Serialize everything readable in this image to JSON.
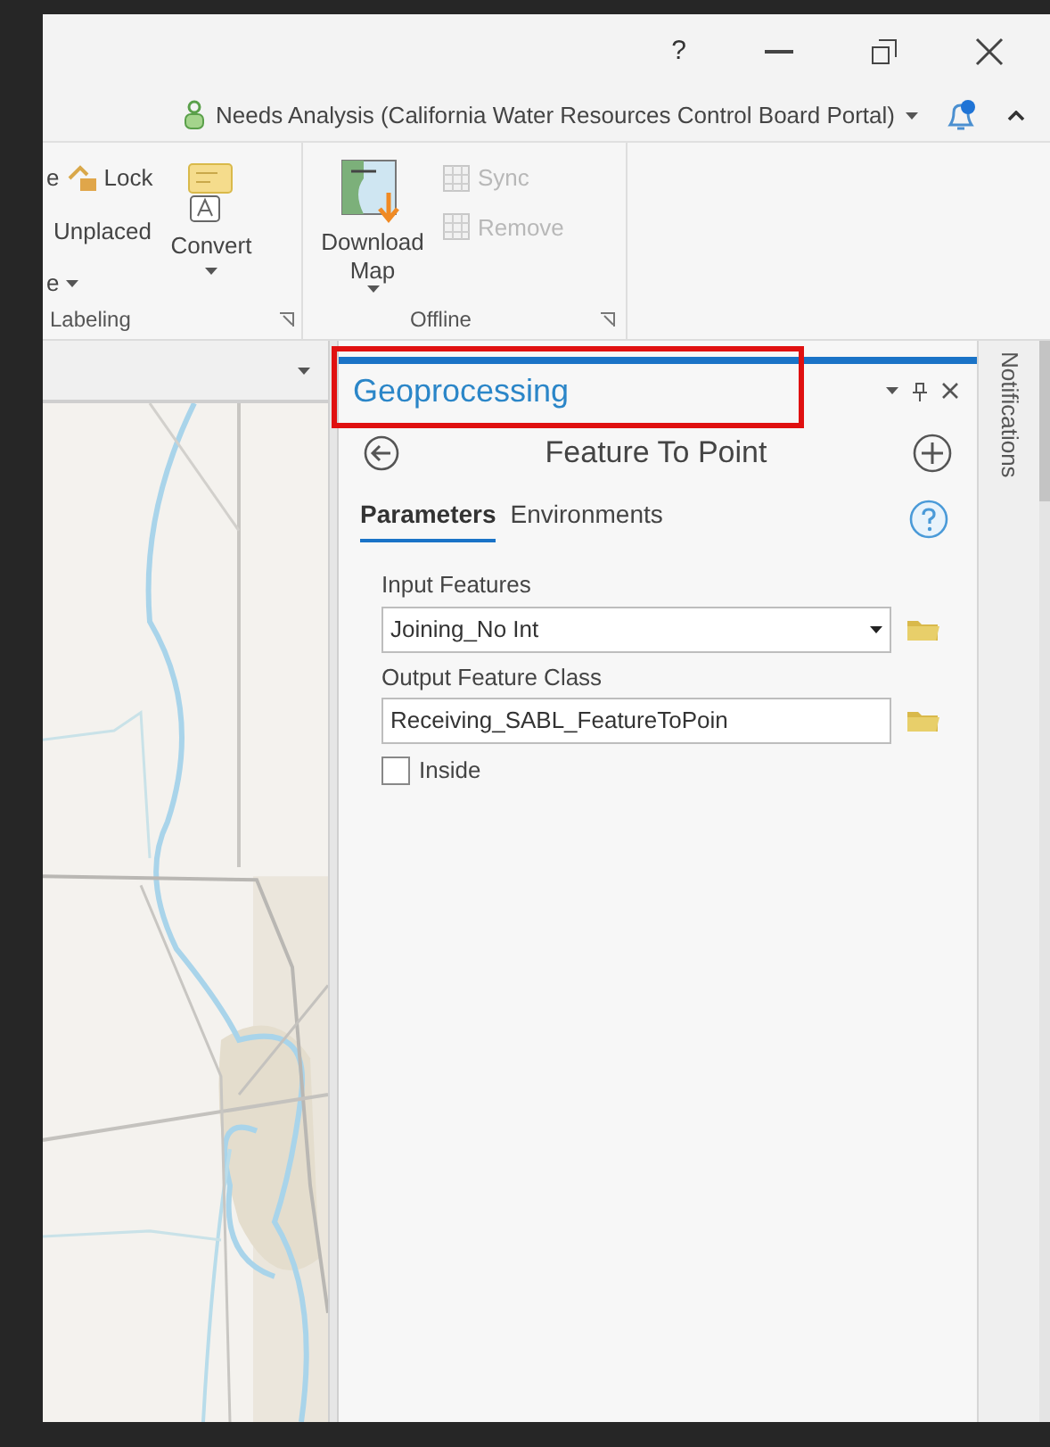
{
  "window": {
    "help": "?"
  },
  "account": {
    "title": "Needs Analysis (California Water Resources Control Board Portal)"
  },
  "labeling": {
    "label": "Labeling",
    "cut_top": "e",
    "cut_bottom": "e",
    "lock": "Lock",
    "unplaced": "Unplaced",
    "convert": "Convert"
  },
  "offline": {
    "label": "Offline",
    "download": "Download Map",
    "actions": [
      {
        "label": "Sync",
        "disabled": true
      },
      {
        "label": "Remove",
        "disabled": true
      }
    ]
  },
  "geoprocessing": {
    "title": "Geoprocessing",
    "tool": "Feature To Point",
    "tabs": [
      {
        "label": "Parameters",
        "selected": true
      },
      {
        "label": "Environments",
        "selected": false
      }
    ],
    "params": [
      {
        "kind": "dropdown",
        "label": "Input Features",
        "value": "Joining_No Int"
      },
      {
        "kind": "text",
        "label": "Output Feature Class",
        "value": "Receiving_SABL_FeatureToPoin"
      },
      {
        "kind": "checkbox",
        "label": "Inside",
        "checked": false
      }
    ]
  },
  "notifications": {
    "label": "Notifications"
  }
}
